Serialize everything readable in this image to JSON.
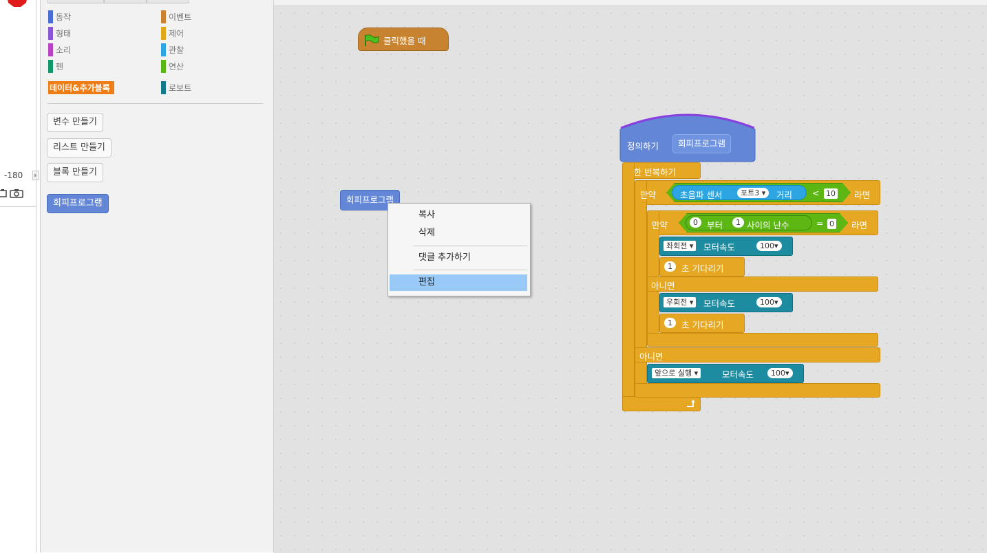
{
  "stage": {
    "x_coord": "-180",
    "icons": [
      "stop-icon",
      "sprite-camera-icon",
      "camera-icon"
    ]
  },
  "palette": {
    "categories_left": [
      {
        "label": "동작",
        "color": "#4a6cd4"
      },
      {
        "label": "형태",
        "color": "#8a55d7"
      },
      {
        "label": "소리",
        "color": "#bb42c3"
      },
      {
        "label": "펜",
        "color": "#0e9a6c"
      },
      {
        "label": "데이터&추가블록",
        "color": "#ee7d16",
        "active": true
      }
    ],
    "categories_right": [
      {
        "label": "이벤트",
        "color": "#c88330"
      },
      {
        "label": "제어",
        "color": "#e1a91a"
      },
      {
        "label": "관찰",
        "color": "#2ca5e2"
      },
      {
        "label": "연산",
        "color": "#5cb712"
      },
      {
        "label": "로보트",
        "color": "#137a8c"
      }
    ],
    "make_variable": "변수 만들기",
    "make_list": "리스트 만들기",
    "make_block": "블록 만들기",
    "custom_block": "회피프로그램"
  },
  "scripts": {
    "when_flag": "클릭했을 때",
    "loose_block": "회피프로그램",
    "define_label": "정의하기",
    "define_name": "회피프로그램",
    "forever": "무한 반복하기",
    "if1": {
      "if_label": "만약",
      "sensor": "초음파 센서",
      "port": "포트3",
      "distance": "거리",
      "op": "<",
      "value": "10",
      "then": "라면"
    },
    "if2": {
      "if_label": "만약",
      "from": "0",
      "from_label": "부터",
      "to": "1",
      "random_label": "사이의 난수",
      "op": "=",
      "value": "0",
      "then": "라면"
    },
    "turn_left": {
      "dir": "좌회전",
      "speed_label": "모터속도",
      "speed": "100"
    },
    "wait1": {
      "sec": "1",
      "label": "초 기다리기"
    },
    "else1": "아니면",
    "turn_right": {
      "dir": "우회전",
      "speed_label": "모터속도",
      "speed": "100"
    },
    "wait2": {
      "sec": "1",
      "label": "초 기다리기"
    },
    "else2": "아니면",
    "forward": {
      "dir": "앞으로 실행",
      "speed_label": "모터속도",
      "speed": "100"
    }
  },
  "context_menu": {
    "items": [
      "복사",
      "삭제",
      "댓글 추가하기",
      "편집"
    ],
    "selected": "편집"
  }
}
